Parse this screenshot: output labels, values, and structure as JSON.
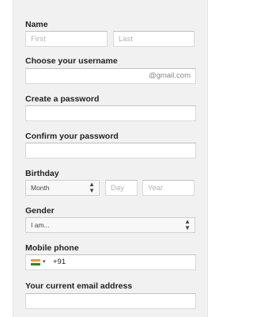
{
  "form": {
    "name": {
      "label": "Name",
      "first_placeholder": "First",
      "last_placeholder": "Last"
    },
    "username": {
      "label": "Choose your username",
      "suffix": "@gmail.com"
    },
    "password": {
      "label": "Create a password"
    },
    "confirm": {
      "label": "Confirm your password"
    },
    "birthday": {
      "label": "Birthday",
      "month": "Month",
      "day_placeholder": "Day",
      "year_placeholder": "Year"
    },
    "gender": {
      "label": "Gender",
      "value": "I am..."
    },
    "mobile": {
      "label": "Mobile phone",
      "dial_code": "+91"
    },
    "current_email": {
      "label": "Your current email address"
    }
  },
  "colors": {
    "panel_bg": "#f1f1f1",
    "field_border": "#d9d9d9"
  }
}
